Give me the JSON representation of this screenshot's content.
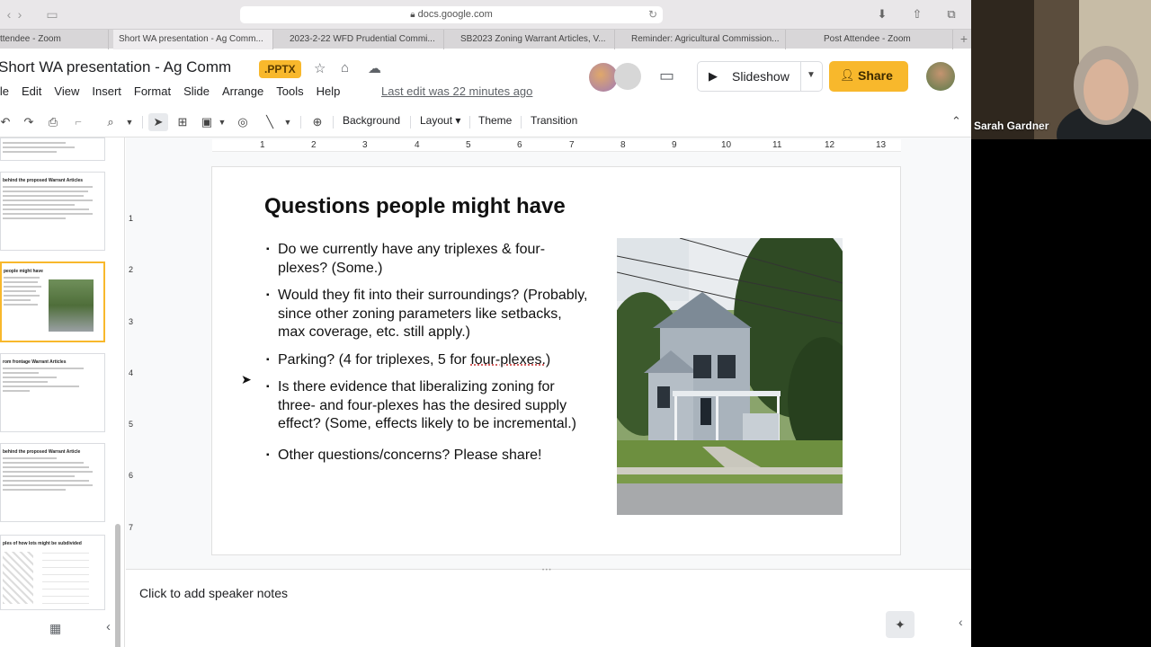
{
  "browser": {
    "url": "docs.google.com",
    "tabs": [
      {
        "label": "ttendee - Zoom"
      },
      {
        "label": "Short WA presentation - Ag Comm..."
      },
      {
        "label": "2023-2-22 WFD Prudential Commi..."
      },
      {
        "label": "SB2023 Zoning Warrant Articles, V..."
      },
      {
        "label": "Reminder: Agricultural Commission..."
      },
      {
        "label": "Post Attendee - Zoom"
      }
    ]
  },
  "doc": {
    "title": "Short WA presentation - Ag Comm",
    "badge": ".PPTX",
    "menus": [
      "ile",
      "Edit",
      "View",
      "Insert",
      "Format",
      "Slide",
      "Arrange",
      "Tools",
      "Help"
    ],
    "last_edit": "Last edit was 22 minutes ago",
    "slideshow_label": "Slideshow",
    "share_label": "Share"
  },
  "toolbar": {
    "background": "Background",
    "layout": "Layout ▾",
    "theme": "Theme",
    "transition": "Transition"
  },
  "ruler": {
    "top": [
      "1",
      "2",
      "3",
      "4",
      "5",
      "6",
      "7",
      "8",
      "9",
      "10",
      "11",
      "12",
      "13"
    ],
    "left": [
      "1",
      "2",
      "3",
      "4",
      "5",
      "6",
      "7"
    ]
  },
  "filmstrip": {
    "thumbs": [
      {
        "title": ""
      },
      {
        "title": "behind the proposed Warrant Articles"
      },
      {
        "title": "people might have"
      },
      {
        "title": "rom frontage Warrant Articles"
      },
      {
        "title": "behind the proposed Warrant Article"
      },
      {
        "title": "ples of how lots might be subdivided"
      }
    ]
  },
  "slide": {
    "title": "Questions people might have",
    "bullets": [
      {
        "text": "Do we currently have any triplexes & four-plexes? (Some.)"
      },
      {
        "text": "Would they fit into their surroundings? (Probably, since other zoning parameters like setbacks, max coverage, etc. still apply.)"
      },
      {
        "pre": "Parking? (4 for triplexes, 5 for ",
        "underlined": "four-plexes.",
        "post": ")"
      },
      {
        "text": "Is there evidence that liberalizing zoning for three- and four-plexes has the desired supply effect? (Some, effects likely to be incremental.)"
      },
      {
        "text": "Other questions/concerns? Please share!"
      }
    ]
  },
  "notes": {
    "placeholder": "Click to add speaker notes"
  },
  "zoom": {
    "participant_name": "Sarah Gardner"
  },
  "colors": {
    "accent": "#f8b82c",
    "text": "#202124"
  }
}
